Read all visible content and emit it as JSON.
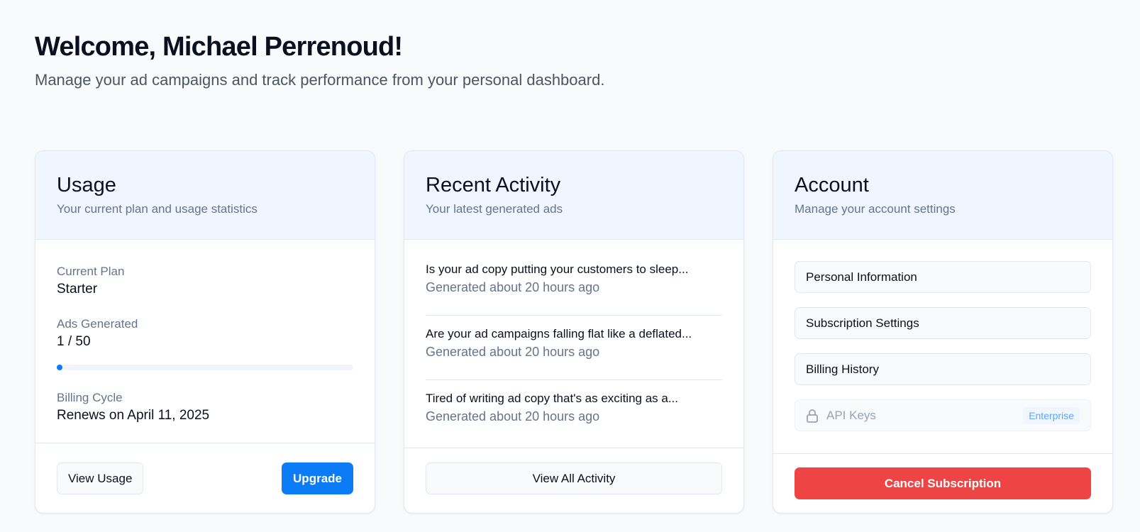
{
  "header": {
    "title": "Welcome, Michael Perrenoud!",
    "subtitle": "Manage your ad campaigns and track performance from your personal dashboard."
  },
  "usage": {
    "title": "Usage",
    "description": "Your current plan and usage statistics",
    "plan_label": "Current Plan",
    "plan_value": "Starter",
    "ads_label": "Ads Generated",
    "ads_value": "1 / 50",
    "ads_progress_fraction": 0.02,
    "billing_label": "Billing Cycle",
    "billing_value": "Renews on April 11, 2025",
    "view_usage_label": "View Usage",
    "upgrade_label": "Upgrade"
  },
  "activity": {
    "title": "Recent Activity",
    "description": "Your latest generated ads",
    "items": [
      {
        "title": "Is your ad copy putting your customers to sleep...",
        "time": "Generated about 20 hours ago"
      },
      {
        "title": "Are your ad campaigns falling flat like a deflated...",
        "time": "Generated about 20 hours ago"
      },
      {
        "title": "Tired of writing ad copy that's as exciting as a...",
        "time": "Generated about 20 hours ago"
      }
    ],
    "view_all_label": "View All Activity"
  },
  "account": {
    "title": "Account",
    "description": "Manage your account settings",
    "items": [
      {
        "label": "Personal Information"
      },
      {
        "label": "Subscription Settings"
      },
      {
        "label": "Billing History"
      }
    ],
    "api_keys_label": "API Keys",
    "api_keys_icon": "lock-icon",
    "api_keys_badge": "Enterprise",
    "cancel_label": "Cancel Subscription"
  },
  "colors": {
    "accent": "#0b7cf5",
    "danger": "#ef4444",
    "card_header_bg": "#eff6ff",
    "page_bg": "#f8fafc"
  }
}
